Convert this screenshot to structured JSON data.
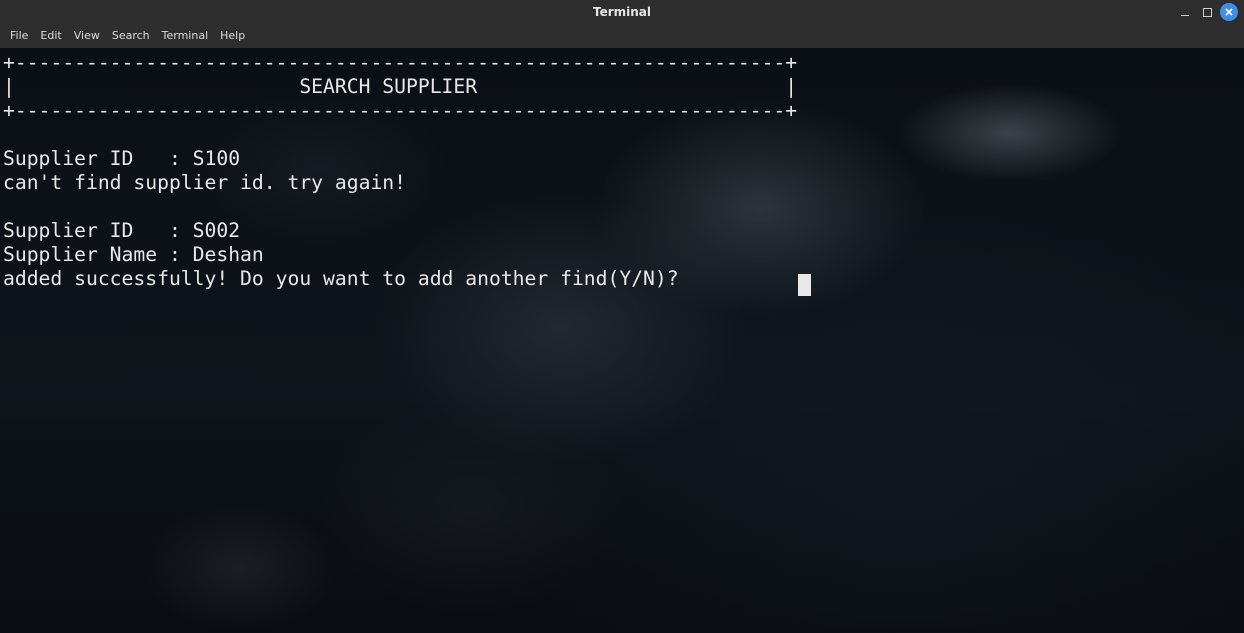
{
  "window": {
    "title": "Terminal"
  },
  "menubar": {
    "items": [
      "File",
      "Edit",
      "View",
      "Search",
      "Terminal",
      "Help"
    ]
  },
  "terminal": {
    "lines": [
      "+-----------------------------------------------------------------+",
      "|                        SEARCH SUPPLIER                          |",
      "+-----------------------------------------------------------------+",
      "",
      "Supplier ID   : S100",
      "can't find supplier id. try again!",
      "",
      "Supplier ID   : S002",
      "Supplier Name : Deshan",
      "added successfully! Do you want to add another find(Y/N)? "
    ]
  },
  "icons": {
    "minimize": "minimize-icon",
    "maximize": "maximize-icon",
    "close": "close-icon"
  },
  "colors": {
    "titlebar": "#2e2e2e",
    "close_button": "#3d8fe8",
    "terminal_text": "#e8e8e8"
  }
}
